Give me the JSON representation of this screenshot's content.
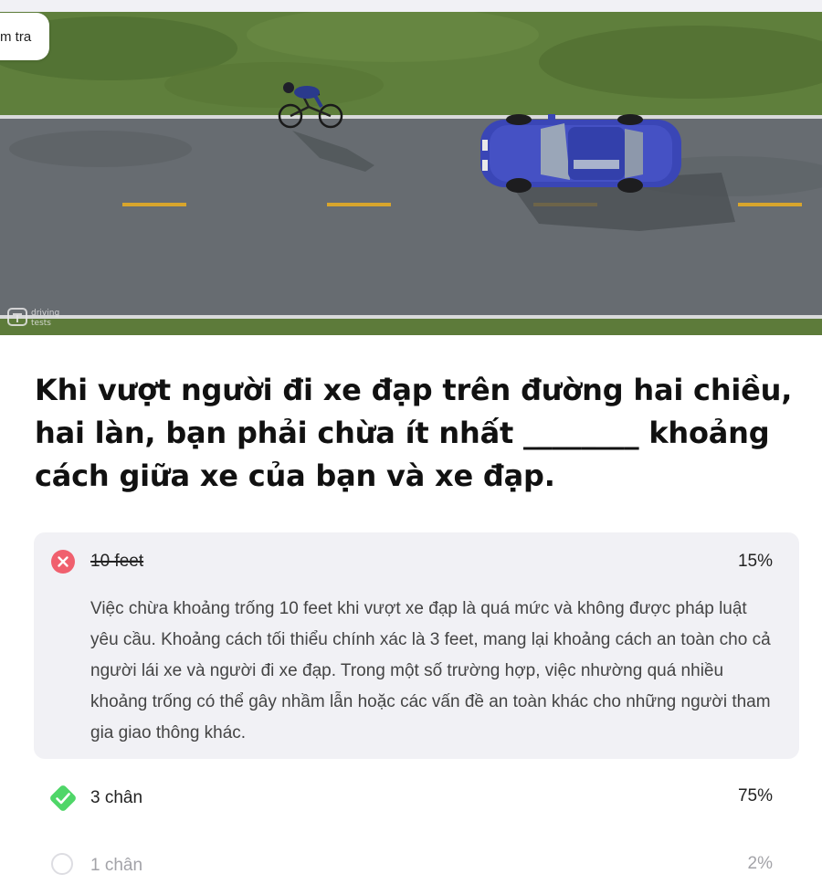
{
  "header": {
    "test_pill_label": "m tra"
  },
  "image": {
    "watermark_line1": "driving",
    "watermark_line2": "tests"
  },
  "question": {
    "text": "Khi vượt người đi xe đạp trên đường hai chiều, hai làn, bạn phải chừa ít nhất ________ khoảng cách giữa xe của bạn và xe đạp."
  },
  "answers": [
    {
      "label": "10 feet",
      "percent": "15%",
      "status": "incorrect",
      "status_icon": "x-circle-icon",
      "status_color": "#f0606e",
      "explanation": "Việc chừa khoảng trống 10 feet khi vượt xe đạp là quá mức và không được pháp luật yêu cầu. Khoảng cách tối thiểu chính xác là 3 feet, mang lại khoảng cách an toàn cho cả người lái xe và người đi xe đạp. Trong một số trường hợp, việc nhường quá nhiều khoảng trống có thể gây nhầm lẫn hoặc các vấn đề an toàn khác cho những người tham gia giao thông khác."
    },
    {
      "label": "3 chân",
      "percent": "75%",
      "status": "correct",
      "status_icon": "check-diamond-icon",
      "status_color": "#4fd668"
    },
    {
      "label": "1 chân",
      "percent": "2%",
      "status": "unselected",
      "status_icon": "empty-circle-icon",
      "status_color": "#dddde2"
    }
  ],
  "colors": {
    "card_background": "#f1f1f5",
    "grass": "#5e7f3a",
    "road": "#666b70",
    "car": "#3b48b8"
  }
}
